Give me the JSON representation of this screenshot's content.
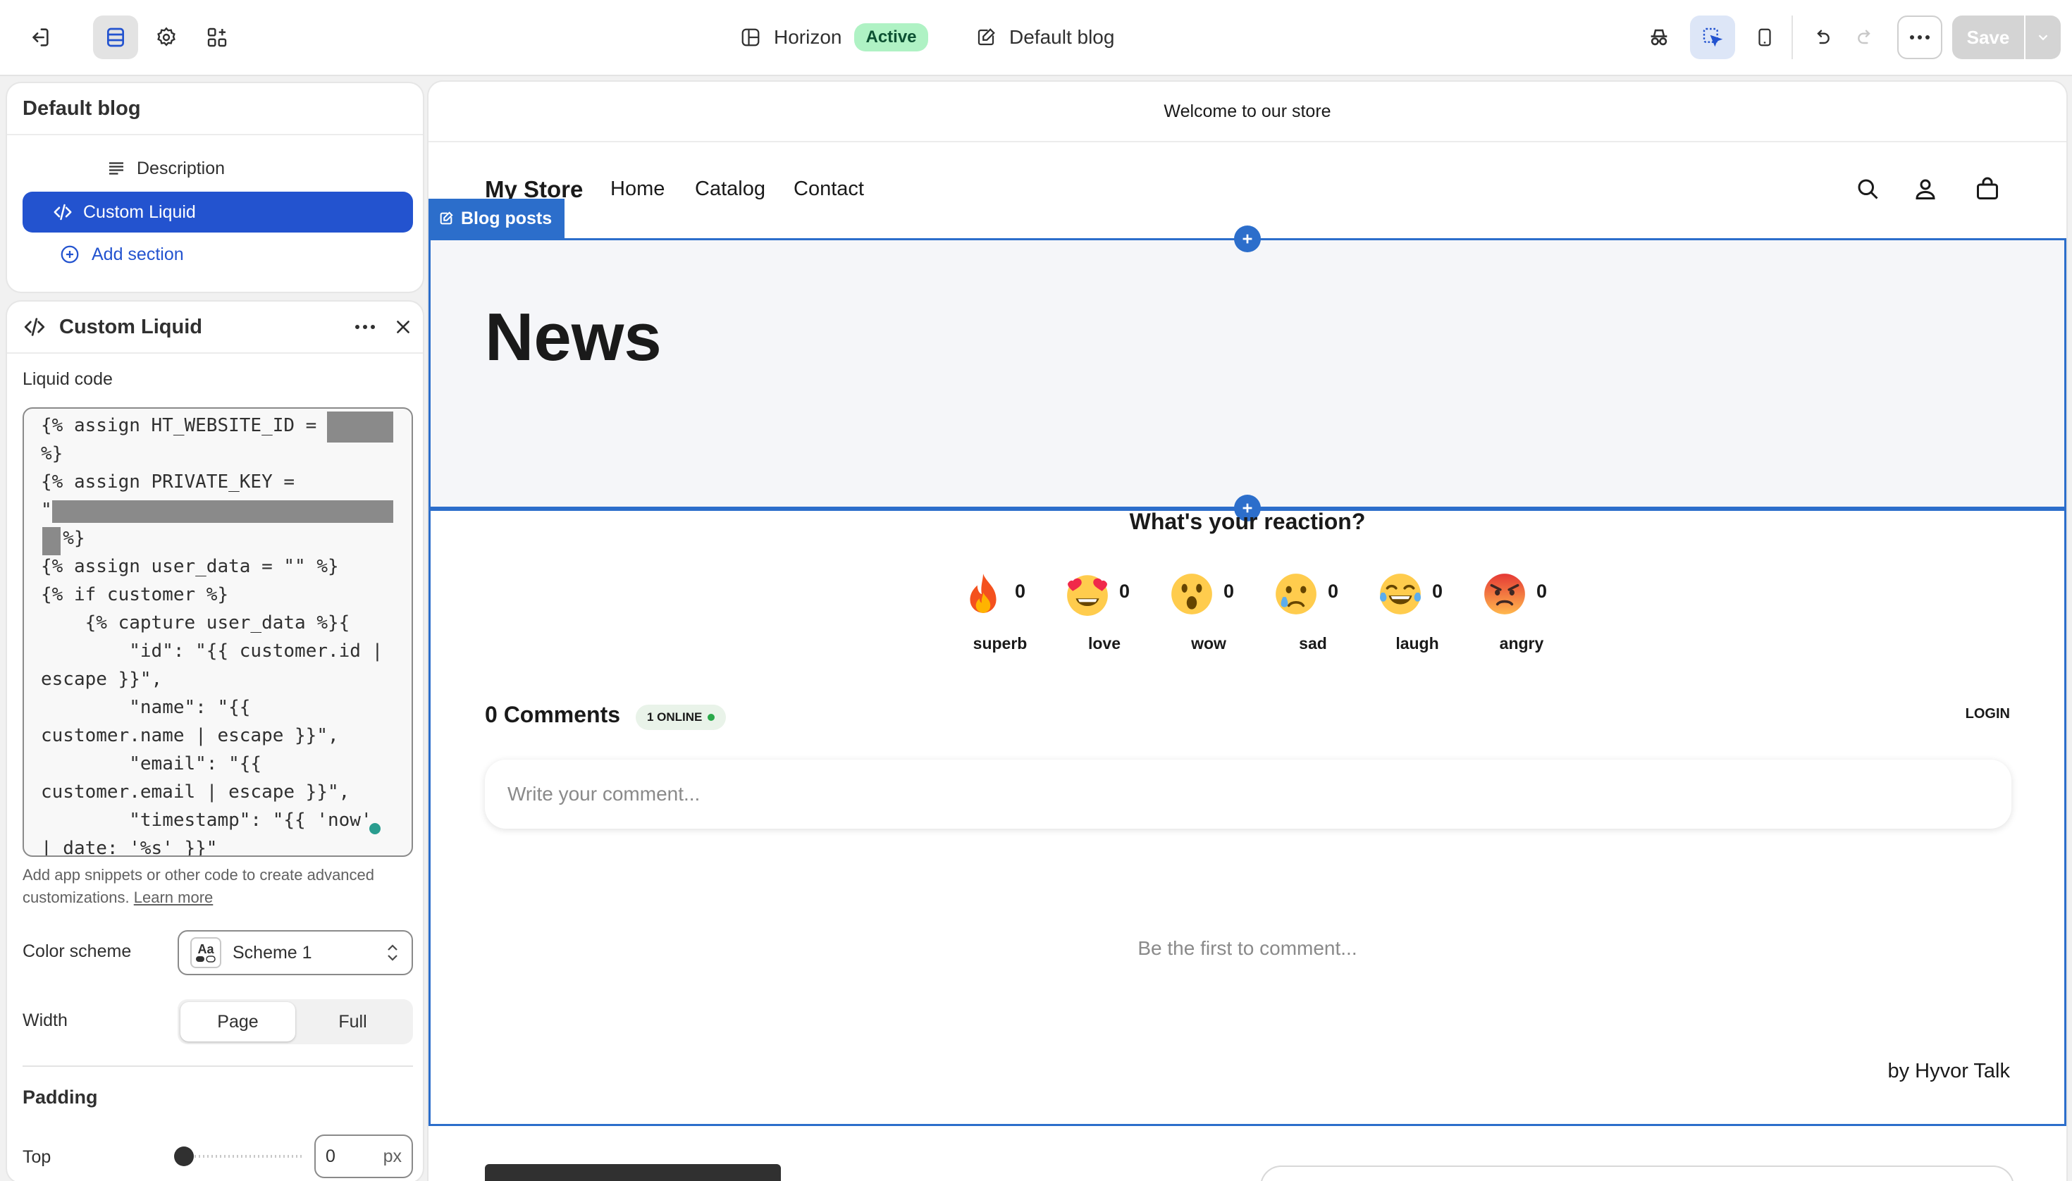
{
  "topbar": {
    "theme_name": "Horizon",
    "theme_status": "Active",
    "template_name": "Default blog",
    "save_label": "Save"
  },
  "sections_panel": {
    "title": "Default blog",
    "items": [
      {
        "label": "Description",
        "icon": "text-lines-icon",
        "selected": false
      },
      {
        "label": "Custom Liquid",
        "icon": "code-icon",
        "selected": true
      }
    ],
    "add_section_label": "Add section"
  },
  "settings_panel": {
    "title": "Custom Liquid",
    "liquid_code_label": "Liquid code",
    "liquid_code": "{% assign HT_WEBSITE_ID = \n%}\n{% assign PRIVATE_KEY = \n\"\n\" %}\n{% assign user_data = \"\" %}\n{% if customer %}\n    {% capture user_data %}{\n        \"id\": \"{{ customer.id |\nescape }}\",\n        \"name\": \"{{\ncustomer.name | escape }}\",\n        \"email\": \"{{\ncustomer.email | escape }}\",\n        \"timestamp\": \"{{ 'now'\n| date: '%s' }}\"",
    "help_text": "Add app snippets or other code to create advanced customizations.",
    "learn_more": "Learn more",
    "color_scheme_label": "Color scheme",
    "color_scheme_value": "Scheme 1",
    "color_scheme_icon_text": "Aa",
    "width_label": "Width",
    "width_options": [
      "Page",
      "Full"
    ],
    "width_selected": "Page",
    "padding_heading": "Padding",
    "top_label": "Top",
    "top_value": "0",
    "top_unit": "px"
  },
  "preview": {
    "announcement": "Welcome to our store",
    "store_name": "My Store",
    "nav": [
      "Home",
      "Catalog",
      "Contact"
    ],
    "selected_section_tag": "Blog posts",
    "page_heading": "News",
    "reaction_question": "What's your reaction?",
    "reactions": [
      {
        "name": "superb",
        "count": "0",
        "icon": "fire-emoji"
      },
      {
        "name": "love",
        "count": "0",
        "icon": "heart-eyes-emoji"
      },
      {
        "name": "wow",
        "count": "0",
        "icon": "astonished-emoji"
      },
      {
        "name": "sad",
        "count": "0",
        "icon": "sad-tear-emoji"
      },
      {
        "name": "laugh",
        "count": "0",
        "icon": "tears-of-joy-emoji"
      },
      {
        "name": "angry",
        "count": "0",
        "icon": "angry-emoji"
      }
    ],
    "comments_title": "0 Comments",
    "online_badge": "1 ONLINE",
    "login_label": "LOGIN",
    "comment_placeholder": "Write your comment...",
    "empty_state": "Be the first to comment...",
    "powered_by": "by Hyvor Talk"
  },
  "colors": {
    "accent_blue": "#2c6ecb",
    "selected_blue": "#2353cf",
    "active_badge_bg": "#aff2c4",
    "active_badge_text": "#0c5132"
  }
}
